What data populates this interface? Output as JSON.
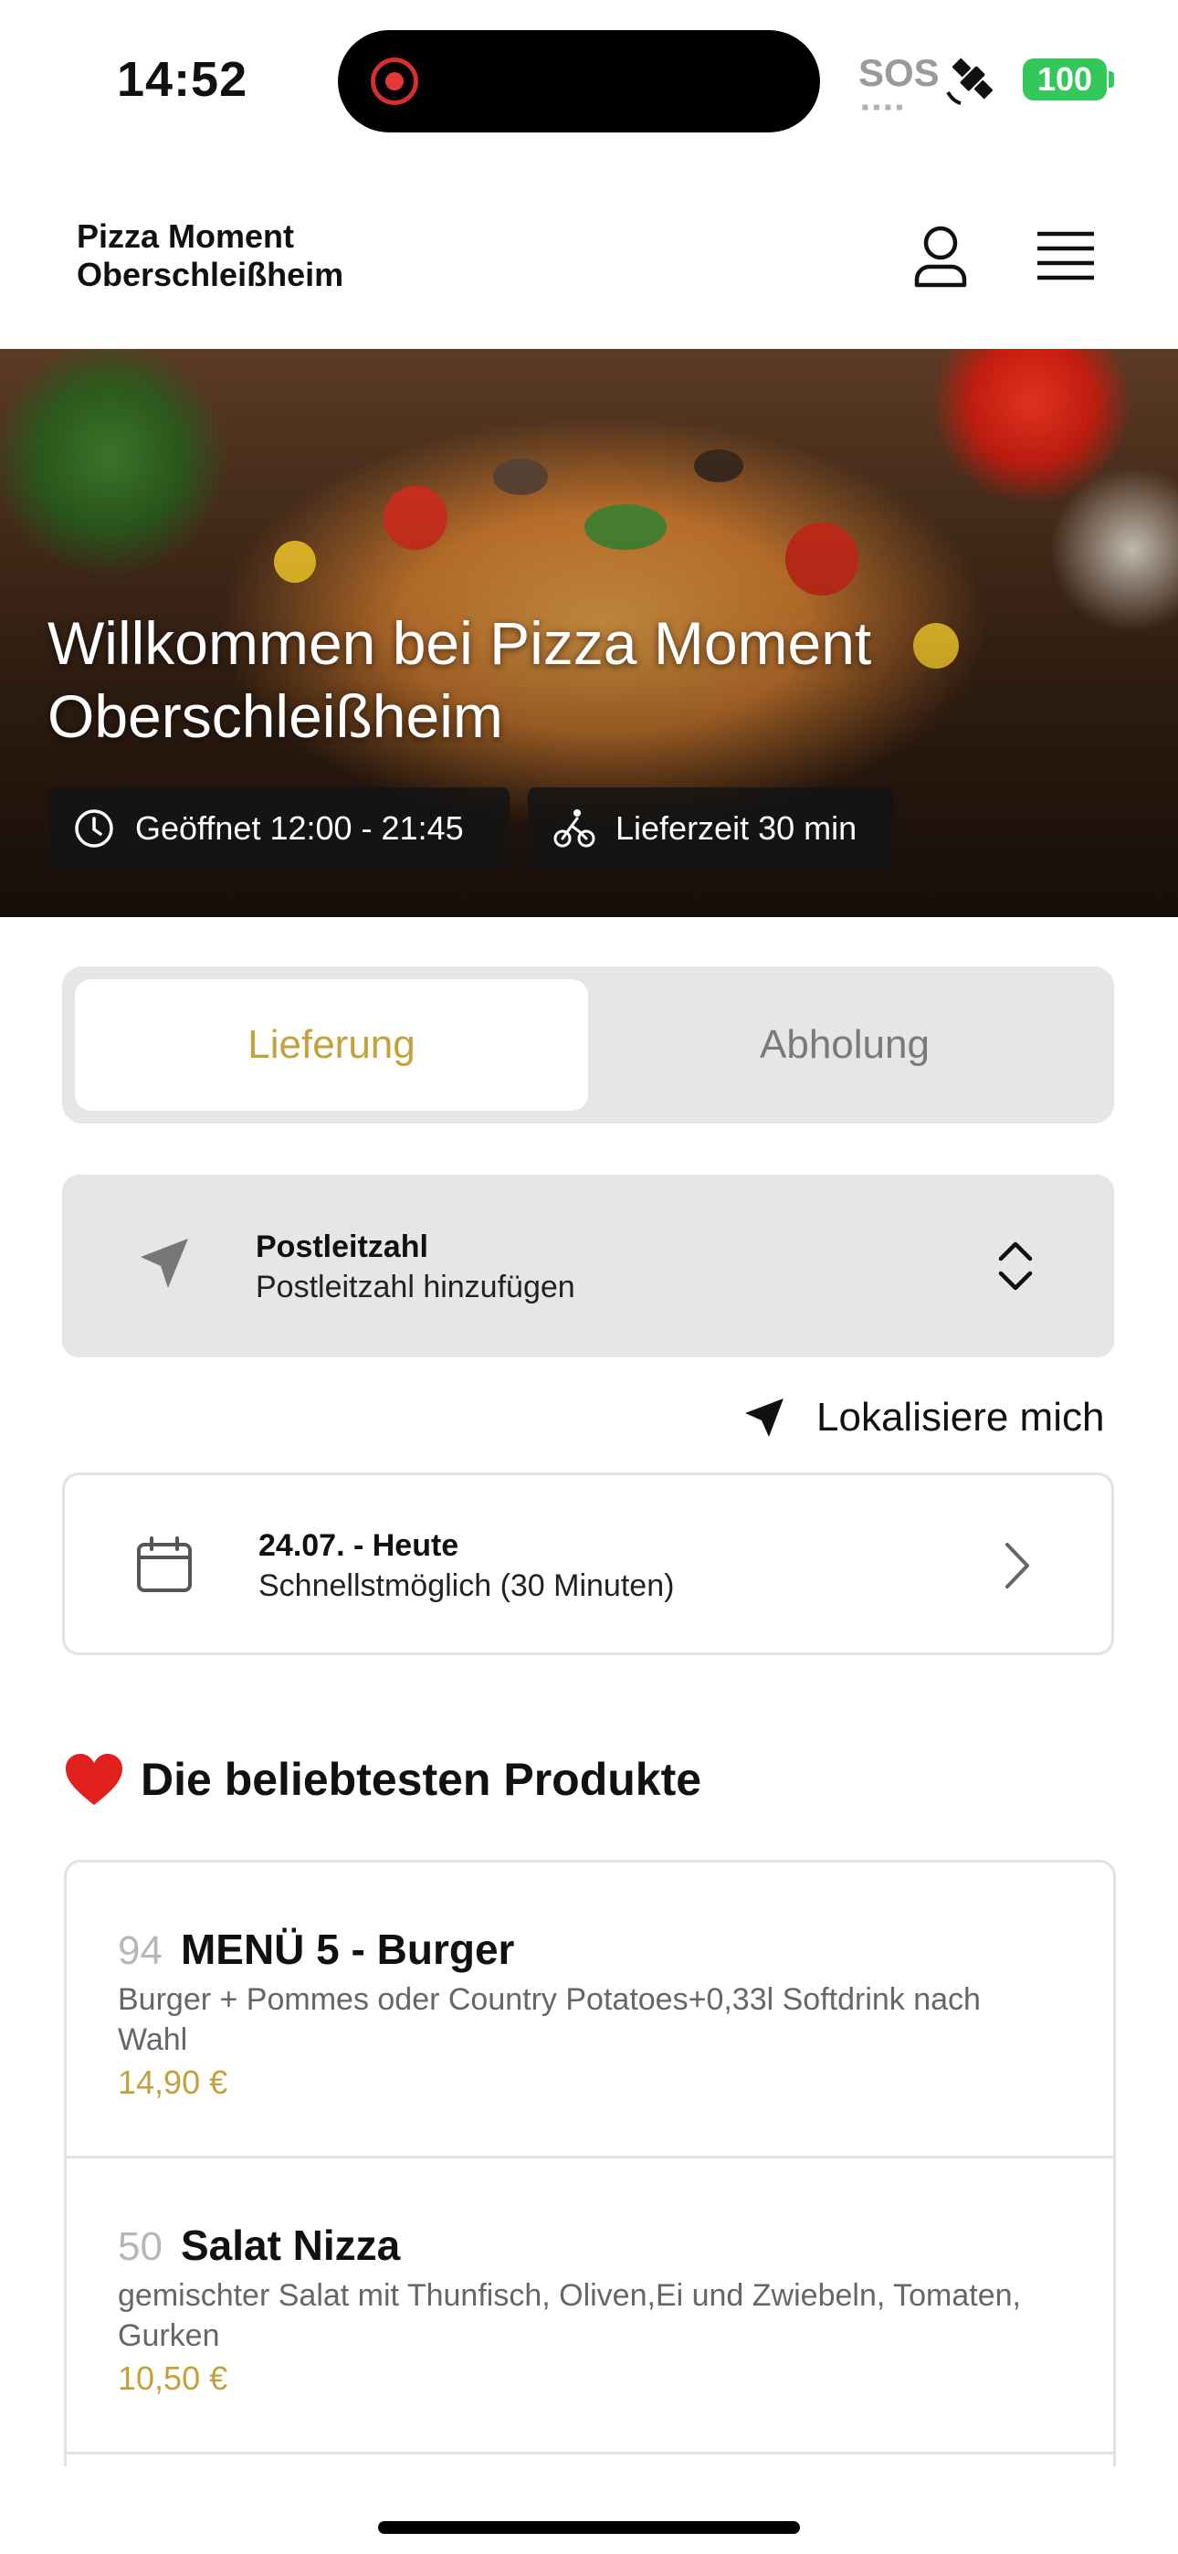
{
  "status_bar": {
    "time": "14:52",
    "sos": "SOS",
    "battery": "100",
    "icons": [
      "recording-dot-icon",
      "satellite-icon",
      "battery-icon"
    ]
  },
  "header": {
    "brand_line1": "Pizza Moment",
    "brand_line2": "Oberschleißheim",
    "icons": [
      "user-icon",
      "menu-icon"
    ]
  },
  "hero": {
    "title_line1": "Willkommen bei Pizza Moment",
    "title_line2": "Oberschleißheim",
    "opening_hours": "Geöffnet 12:00 - 21:45",
    "delivery_time": "Lieferzeit 30 min"
  },
  "mode_toggle": {
    "delivery": "Lieferung",
    "pickup": "Abholung",
    "selected": "Lieferung"
  },
  "postal_code": {
    "title": "Postleitzahl",
    "placeholder": "Postleitzahl hinzufügen"
  },
  "locate_me": "Lokalisiere mich",
  "schedule": {
    "date": "24.07. - Heute",
    "time": "Schnellstmöglich (30 Minuten)"
  },
  "popular": {
    "title": "Die beliebtesten Produkte",
    "products": [
      {
        "number": "94",
        "name": "MENÜ 5 - Burger",
        "description": "Burger + Pommes oder Country Potatoes+0,33l Softdrink nach Wahl",
        "price": "14,90 €"
      },
      {
        "number": "50",
        "name": "Salat Nizza",
        "description": "gemischter Salat mit Thunfisch, Oliven,Ei und Zwiebeln, Tomaten, Gurken",
        "price": "10,50 €"
      }
    ]
  },
  "colors": {
    "accent_gold": "#c3a23d",
    "battery_green": "#34c759",
    "panel_grey": "#e6e6e6"
  }
}
